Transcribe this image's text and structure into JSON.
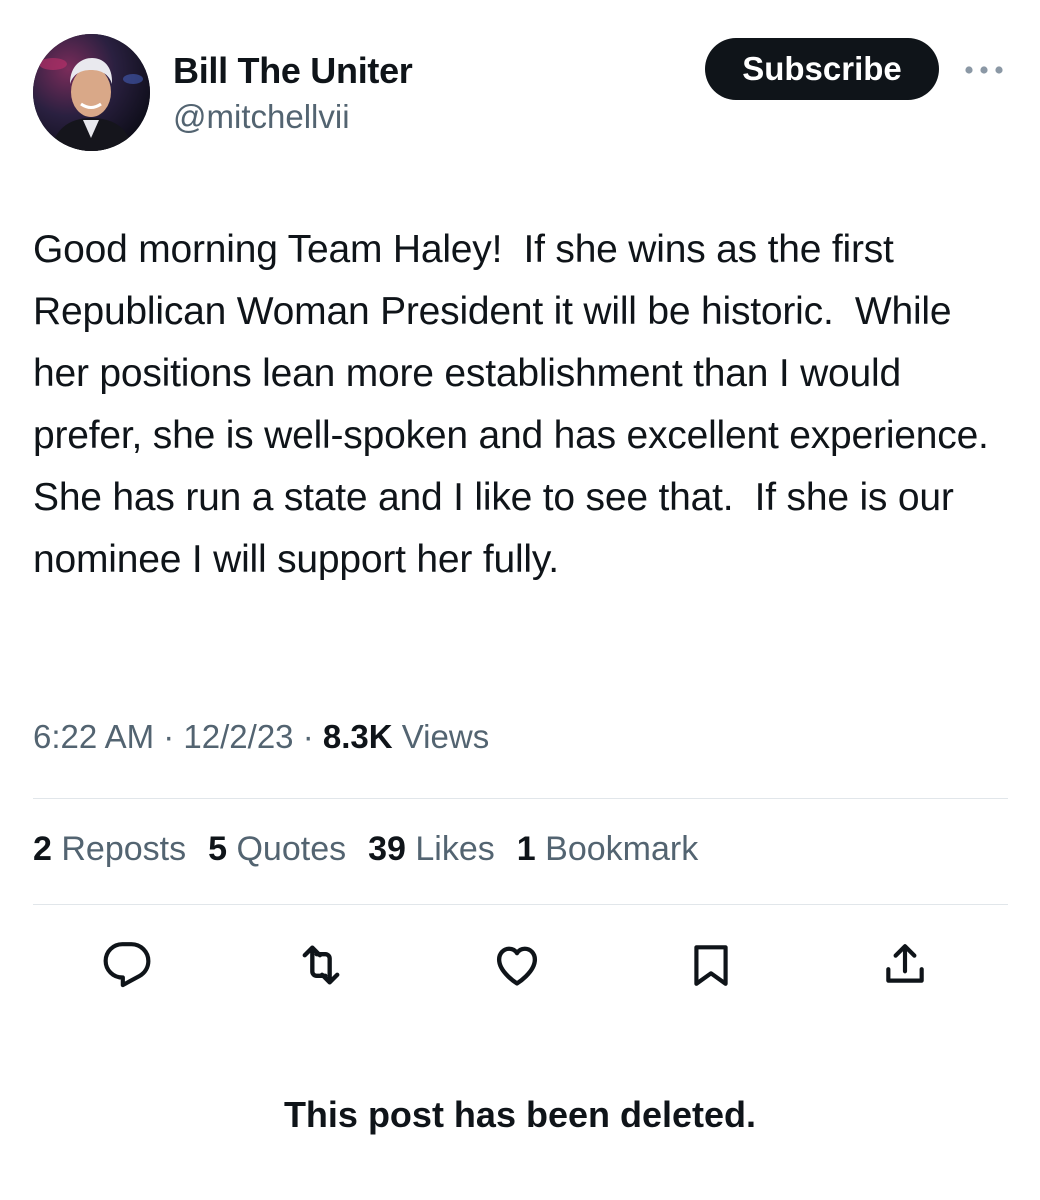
{
  "author": {
    "name": "Bill The Uniter",
    "handle": "@mitchellvii",
    "avatar_icon": "profile-photo"
  },
  "subscribe_label": "Subscribe",
  "more_icon": "more-horizontal-icon",
  "tweet": {
    "text": "Good morning Team Haley!  If she wins as the first Republican Woman President it will be historic.  While her positions lean more establishment than I would prefer, she is well-spoken and has excellent experience.  She has run a state and I like to see that.  If she is our nominee I will support her fully.",
    "time": "6:22 AM",
    "date": "12/2/23",
    "separator": "·",
    "views_count": "8.3K",
    "views_label": "Views"
  },
  "stats": [
    {
      "count": "2",
      "label": "Reposts"
    },
    {
      "count": "5",
      "label": "Quotes"
    },
    {
      "count": "39",
      "label": "Likes"
    },
    {
      "count": "1",
      "label": "Bookmark"
    }
  ],
  "actions": [
    {
      "icon": "reply-icon"
    },
    {
      "icon": "repost-icon"
    },
    {
      "icon": "like-icon"
    },
    {
      "icon": "bookmark-icon"
    },
    {
      "icon": "share-icon"
    }
  ],
  "deleted_notice": "This post has been deleted.",
  "colors": {
    "text_primary": "#0f1419",
    "text_secondary": "#536471",
    "divider": "#e1e6ea",
    "button_bg": "#0f1419"
  }
}
